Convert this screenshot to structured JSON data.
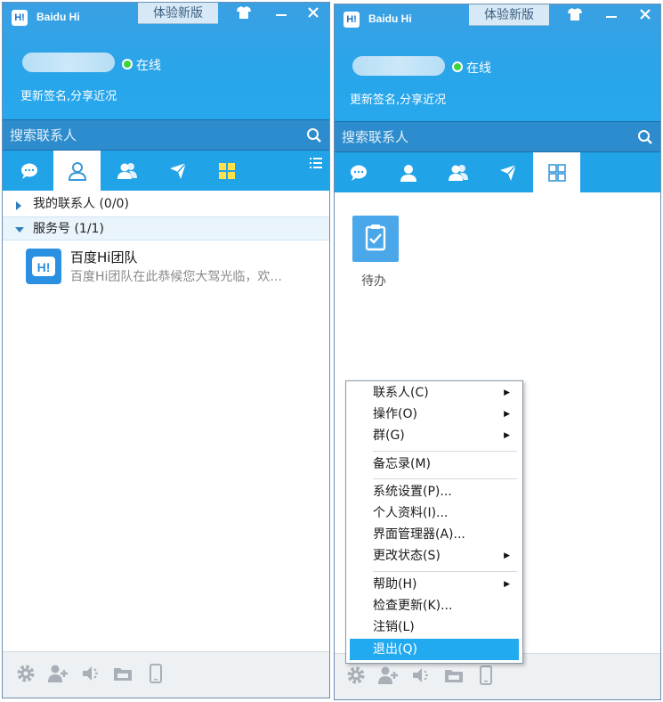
{
  "colors": {
    "header_blue": "#27a8ee",
    "search_blue": "#2d8ccd",
    "online_green": "#3dd43d",
    "menu_highlight": "#22aaf0",
    "bottom_bar": "#eef1f4"
  },
  "app": {
    "logo_text": "H!",
    "name": "Baidu Hi",
    "try_new_label": "体验新版",
    "status": "在线",
    "signature": "更新签名,分享近况",
    "search_placeholder": "搜索联系人"
  },
  "left_window": {
    "active_tab": "contacts",
    "tabs": [
      {
        "icon": "chat-bubble-icon"
      },
      {
        "icon": "contact-person-icon"
      },
      {
        "icon": "group-people-icon"
      },
      {
        "icon": "send-arrow-icon"
      },
      {
        "icon": "apps-grid-icon"
      }
    ],
    "groups": [
      {
        "label": "我的联系人 (0/0)",
        "expanded": false
      },
      {
        "label": "服务号 (1/1)",
        "expanded": true
      }
    ],
    "contact": {
      "name": "百度Hi团队",
      "last_message": "百度Hi团队在此恭候您大驾光临，欢..."
    }
  },
  "right_window": {
    "active_tab": "apps",
    "app_item": {
      "label": "待办",
      "icon": "todo-checklist-icon"
    }
  },
  "context_menu": {
    "items": [
      {
        "label": "联系人(C)",
        "submenu": true
      },
      {
        "label": "操作(O)",
        "submenu": true
      },
      {
        "label": "群(G)",
        "submenu": true
      },
      {
        "label": "备忘录(M)",
        "submenu": false
      },
      {
        "label": "系统设置(P)...",
        "submenu": false
      },
      {
        "label": "个人资料(I)...",
        "submenu": false
      },
      {
        "label": "界面管理器(A)...",
        "submenu": false
      },
      {
        "label": "更改状态(S)",
        "submenu": true
      },
      {
        "label": "帮助(H)",
        "submenu": true
      },
      {
        "label": "检查更新(K)...",
        "submenu": false
      },
      {
        "label": "注销(L)",
        "submenu": false
      },
      {
        "label": "退出(Q)",
        "submenu": false,
        "highlighted": true
      }
    ]
  },
  "bottom_icons": [
    "settings-gear-icon",
    "add-contact-icon",
    "sound-mute-icon",
    "folder-icon",
    "mobile-phone-icon"
  ]
}
